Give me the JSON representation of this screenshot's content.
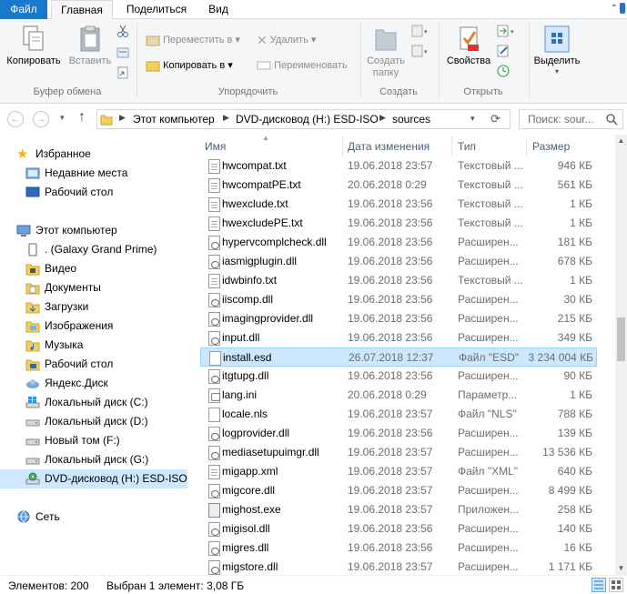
{
  "ribbon_tabs": [
    "Файл",
    "Главная",
    "Поделиться",
    "Вид"
  ],
  "ribbon": {
    "copy": "Копировать",
    "paste": "Вставить",
    "move_to": "Переместить в",
    "copy_to": "Копировать в",
    "delete": "Удалить",
    "rename": "Переименовать",
    "new_folder_1": "Создать",
    "new_folder_2": "папку",
    "properties": "Свойства",
    "select": "Выделить",
    "groups": [
      "Буфер обмена",
      "Упорядочить",
      "Создать",
      "Открыть"
    ]
  },
  "address": {
    "crumbs": [
      "Этот компьютер",
      "DVD-дисковод (H:) ESD-ISO",
      "sources"
    ],
    "search_placeholder": "Поиск: sour..."
  },
  "nav": {
    "favorites": "Избранное",
    "fav_items": [
      "Недавние места",
      "Рабочий стол"
    ],
    "this_pc": "Этот компьютер",
    "pc_items": [
      ". (Galaxy Grand Prime)",
      "Видео",
      "Документы",
      "Загрузки",
      "Изображения",
      "Музыка",
      "Рабочий стол",
      "Яндекс.Диск",
      "Локальный диск (C:)",
      "Локальный диск (D:)",
      "Новый том (F:)",
      "Локальный диск (G:)",
      "DVD-дисковод (H:) ESD-ISO"
    ],
    "network": "Сеть"
  },
  "columns": [
    "Имя",
    "Дата изменения",
    "Тип",
    "Размер"
  ],
  "files": [
    {
      "name": "hwcompat.txt",
      "date": "19.06.2018 23:57",
      "type": "Текстовый ...",
      "size": "946 КБ",
      "kind": "txt"
    },
    {
      "name": "hwcompatPE.txt",
      "date": "20.06.2018 0:29",
      "type": "Текстовый ...",
      "size": "561 КБ",
      "kind": "txt"
    },
    {
      "name": "hwexclude.txt",
      "date": "19.06.2018 23:56",
      "type": "Текстовый ...",
      "size": "1 КБ",
      "kind": "txt"
    },
    {
      "name": "hwexcludePE.txt",
      "date": "19.06.2018 23:56",
      "type": "Текстовый ...",
      "size": "1 КБ",
      "kind": "txt"
    },
    {
      "name": "hypervcomplcheck.dll",
      "date": "19.06.2018 23:56",
      "type": "Расширен...",
      "size": "181 КБ",
      "kind": "dll"
    },
    {
      "name": "iasmigplugin.dll",
      "date": "19.06.2018 23:56",
      "type": "Расширен...",
      "size": "678 КБ",
      "kind": "dll"
    },
    {
      "name": "idwbinfo.txt",
      "date": "19.06.2018 23:56",
      "type": "Текстовый ...",
      "size": "1 КБ",
      "kind": "txt"
    },
    {
      "name": "iiscomp.dll",
      "date": "19.06.2018 23:56",
      "type": "Расширен...",
      "size": "30 КБ",
      "kind": "dll"
    },
    {
      "name": "imagingprovider.dll",
      "date": "19.06.2018 23:56",
      "type": "Расширен...",
      "size": "215 КБ",
      "kind": "dll"
    },
    {
      "name": "input.dll",
      "date": "19.06.2018 23:56",
      "type": "Расширен...",
      "size": "349 КБ",
      "kind": "dll"
    },
    {
      "name": "install.esd",
      "date": "26.07.2018 12:37",
      "type": "Файл \"ESD\"",
      "size": "3 234 004 КБ",
      "kind": "blank",
      "selected": true
    },
    {
      "name": "itgtupg.dll",
      "date": "19.06.2018 23:56",
      "type": "Расширен...",
      "size": "90 КБ",
      "kind": "dll"
    },
    {
      "name": "lang.ini",
      "date": "20.06.2018 0:29",
      "type": "Параметр...",
      "size": "1 КБ",
      "kind": "ini"
    },
    {
      "name": "locale.nls",
      "date": "19.06.2018 23:57",
      "type": "Файл \"NLS\"",
      "size": "788 КБ",
      "kind": "blank"
    },
    {
      "name": "logprovider.dll",
      "date": "19.06.2018 23:56",
      "type": "Расширен...",
      "size": "139 КБ",
      "kind": "dll"
    },
    {
      "name": "mediasetupuimgr.dll",
      "date": "19.06.2018 23:57",
      "type": "Расширен...",
      "size": "13 536 КБ",
      "kind": "dll"
    },
    {
      "name": "migapp.xml",
      "date": "19.06.2018 23:57",
      "type": "Файл \"XML\"",
      "size": "640 КБ",
      "kind": "xml"
    },
    {
      "name": "migcore.dll",
      "date": "19.06.2018 23:57",
      "type": "Расширен...",
      "size": "8 499 КБ",
      "kind": "dll"
    },
    {
      "name": "mighost.exe",
      "date": "19.06.2018 23:57",
      "type": "Приложен...",
      "size": "258 КБ",
      "kind": "exe"
    },
    {
      "name": "migisol.dll",
      "date": "19.06.2018 23:56",
      "type": "Расширен...",
      "size": "140 КБ",
      "kind": "dll"
    },
    {
      "name": "migres.dll",
      "date": "19.06.2018 23:56",
      "type": "Расширен...",
      "size": "16 КБ",
      "kind": "dll"
    },
    {
      "name": "migstore.dll",
      "date": "19.06.2018 23:57",
      "type": "Расширен...",
      "size": "1 171 КБ",
      "kind": "dll"
    }
  ],
  "status": {
    "items": "Элементов: 200",
    "selected": "Выбран 1 элемент: 3,08 ГБ"
  },
  "colors": {
    "accent": "#1979ca",
    "selection": "#cce8ff",
    "selection_border": "#99d1ff"
  }
}
